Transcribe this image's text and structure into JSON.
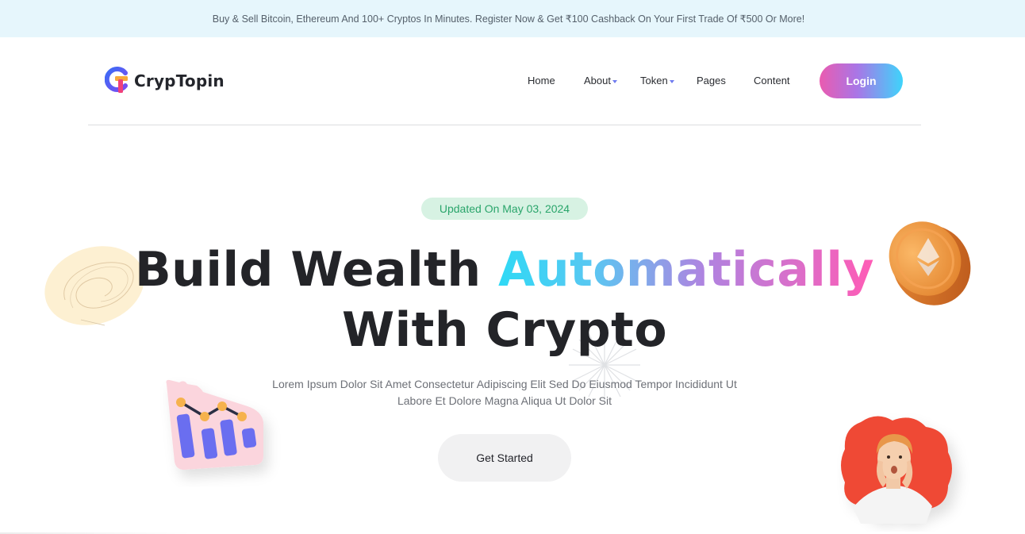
{
  "announcement": "Buy & Sell Bitcoin, Ethereum And 100+ Cryptos In Minutes. Register Now & Get ₹100 Cashback On Your First Trade Of ₹500 Or More!",
  "brand": {
    "name": "CrypTopin",
    "logo_icon": "logo-icon"
  },
  "nav": {
    "items": [
      {
        "label": "Home",
        "dropdown": false
      },
      {
        "label": "About",
        "dropdown": true
      },
      {
        "label": "Token",
        "dropdown": true
      },
      {
        "label": "Pages",
        "dropdown": false
      },
      {
        "label": "Content",
        "dropdown": false
      }
    ],
    "login_label": "Login"
  },
  "hero": {
    "badge": "Updated On May 03, 2024",
    "title_part1": "Build Wealth",
    "title_highlight": "Automatically",
    "title_part2": "With Crypto",
    "description_line1": "Lorem Ipsum Dolor Sit Amet Consectetur Adipiscing Elit Sed Do Eiusmod Tempor Incididunt Ut",
    "description_line2": "Labore Et Dolore Magna Aliqua Ut Dolor Sit",
    "cta_label": "Get Started"
  },
  "decorations": [
    "scribble-icon",
    "chart-sticker-icon",
    "ethereum-coin-icon",
    "sparkle-icon",
    "person-sticker-icon"
  ],
  "colors": {
    "topbar_bg": "#e6f6fc",
    "badge_bg": "#d7f2e3",
    "badge_text": "#2aa56b",
    "gradient_start": "#2fd9f5",
    "gradient_end": "#ff5cb5",
    "login_gradient_start": "#ea5bb0",
    "login_gradient_end": "#3ed4fb"
  }
}
